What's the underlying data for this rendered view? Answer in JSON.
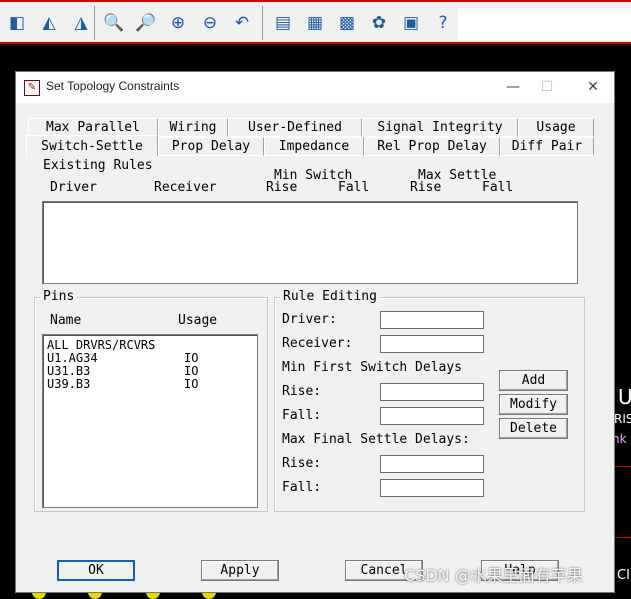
{
  "toolbar": {
    "icons": [
      "page-edge-icon",
      "zoom-region-icon",
      "zoom-out-region-icon",
      "zoom-window-icon",
      "zoom-select-icon",
      "zoom-in-icon",
      "zoom-out-icon",
      "zoom-previous-icon",
      "report-icon",
      "sheet-icon",
      "signal-icon",
      "net-icon",
      "database-icon",
      "help-icon"
    ]
  },
  "dialog": {
    "title": "Set Topology Constraints",
    "tabs_row1": [
      "Max Parallel",
      "Wiring",
      "User-Defined",
      "Signal Integrity",
      "Usage"
    ],
    "tabs_row2": [
      "Switch-Settle",
      "Prop Delay",
      "Impedance",
      "Rel Prop Delay",
      "Diff Pair"
    ],
    "active_tab": "Switch-Settle",
    "existing_rules": {
      "title": "Existing Rules",
      "col_driver": "Driver",
      "col_receiver": "Receiver",
      "col_min_switch": "Min Switch",
      "col_max_settle": "Max Settle",
      "col_rise_1": "Rise",
      "col_fall_1": "Fall",
      "col_rise_2": "Rise",
      "col_fall_2": "Fall"
    },
    "pins": {
      "title": "Pins",
      "col_name": "Name",
      "col_usage": "Usage",
      "rows": [
        {
          "name": "ALL DRVRS/RCVRS",
          "usage": ""
        },
        {
          "name": "U1.AG34",
          "usage": "IO"
        },
        {
          "name": "U31.B3",
          "usage": "IO"
        },
        {
          "name": "U39.B3",
          "usage": "IO"
        }
      ]
    },
    "rule_editing": {
      "title": "Rule Editing",
      "driver_label": "Driver:",
      "receiver_label": "Receiver:",
      "min_first_label": "Min First Switch Delays",
      "rise_label": "Rise:",
      "fall_label": "Fall:",
      "max_final_label": "Max Final Settle Delays:",
      "rise2_label": "Rise:",
      "fall2_label": "Fall:",
      "add": "Add",
      "modify": "Modify",
      "delete": "Delete"
    },
    "buttons": {
      "ok": "OK",
      "apply": "Apply",
      "cancel": "Cancel",
      "help": "Help"
    }
  },
  "side": {
    "u": "U",
    "ris": "RIS",
    "nk": "nk",
    "cr": "CI"
  },
  "watermark": "CSDN @水果里面有苹果"
}
